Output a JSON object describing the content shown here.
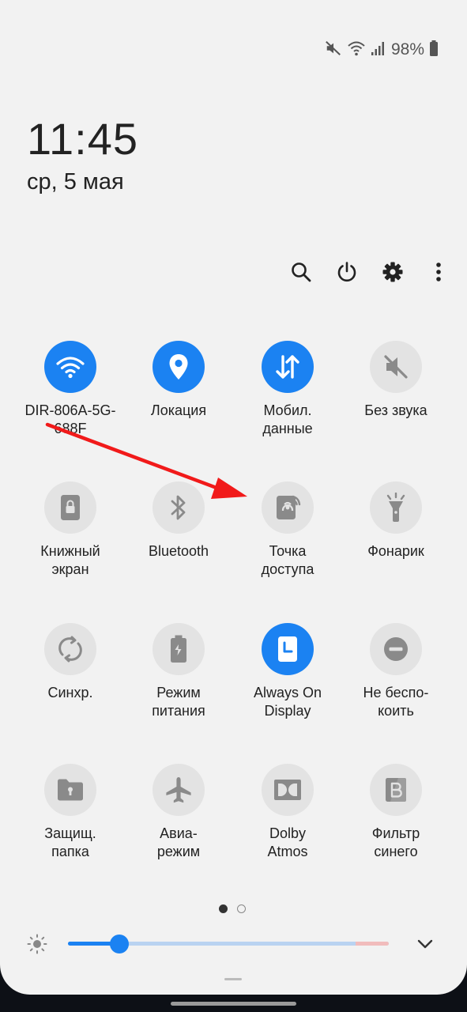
{
  "status_bar": {
    "icons": [
      "mute-icon",
      "wifi-icon",
      "signal-icon",
      "battery-icon"
    ],
    "battery_text": "98%"
  },
  "clock": {
    "time": "11:45",
    "date": "ср, 5 мая"
  },
  "top_actions": [
    "search-icon",
    "power-icon",
    "gear-icon",
    "more-vert-icon"
  ],
  "tiles": [
    {
      "label": "DIR-806A-5G-\n688F",
      "icon": "wifi-icon",
      "on": true
    },
    {
      "label": "Локация",
      "icon": "location-pin-icon",
      "on": true
    },
    {
      "label": "Мобил.\nданные",
      "icon": "mobile-data-arrows-icon",
      "on": true
    },
    {
      "label": "Без звука",
      "icon": "mute-icon",
      "on": false
    },
    {
      "label": "Книжный\nэкран",
      "icon": "portrait-lock-icon",
      "on": false
    },
    {
      "label": "Bluetooth",
      "icon": "bluetooth-icon",
      "on": false
    },
    {
      "label": "Точка\nдоступа",
      "icon": "hotspot-icon",
      "on": false
    },
    {
      "label": "Фонарик",
      "icon": "flashlight-icon",
      "on": false
    },
    {
      "label": "Синхр.",
      "icon": "sync-icon",
      "on": false
    },
    {
      "label": "Режим\nпитания",
      "icon": "power-saving-icon",
      "on": false
    },
    {
      "label": "Always On\nDisplay",
      "icon": "always-on-display-icon",
      "on": true
    },
    {
      "label": "Не беспо-\nкоить",
      "icon": "do-not-disturb-icon",
      "on": false
    },
    {
      "label": "Защищ.\nпапка",
      "icon": "secure-folder-icon",
      "on": false
    },
    {
      "label": "Авиа-\nрежим",
      "icon": "airplane-icon",
      "on": false
    },
    {
      "label": "Dolby\nAtmos",
      "icon": "dolby-icon",
      "on": false
    },
    {
      "label": "Фильтр\nсинего",
      "icon": "blue-light-filter-icon",
      "on": false
    }
  ],
  "pager": {
    "pages": 2,
    "current": 1
  },
  "brightness": {
    "level": 0.16
  },
  "colors": {
    "accent": "#1b82f2",
    "tile_off": "#e3e3e3",
    "panel_bg": "#f2f2f2",
    "annotation_arrow": "#f11a1a"
  }
}
